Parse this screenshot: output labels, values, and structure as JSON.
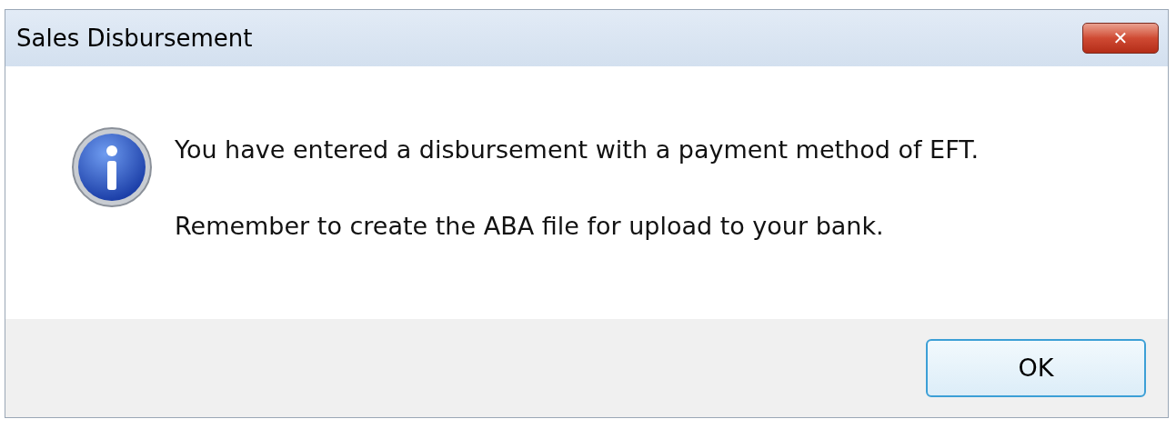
{
  "window": {
    "title": "Sales Disbursement",
    "close_button": "✕"
  },
  "message": {
    "lines": [
      "You have entered a disbursement with a payment method of EFT.",
      "Remember to create the ABA file for upload to your bank."
    ]
  },
  "buttons": [
    {
      "label": "OK"
    }
  ]
}
